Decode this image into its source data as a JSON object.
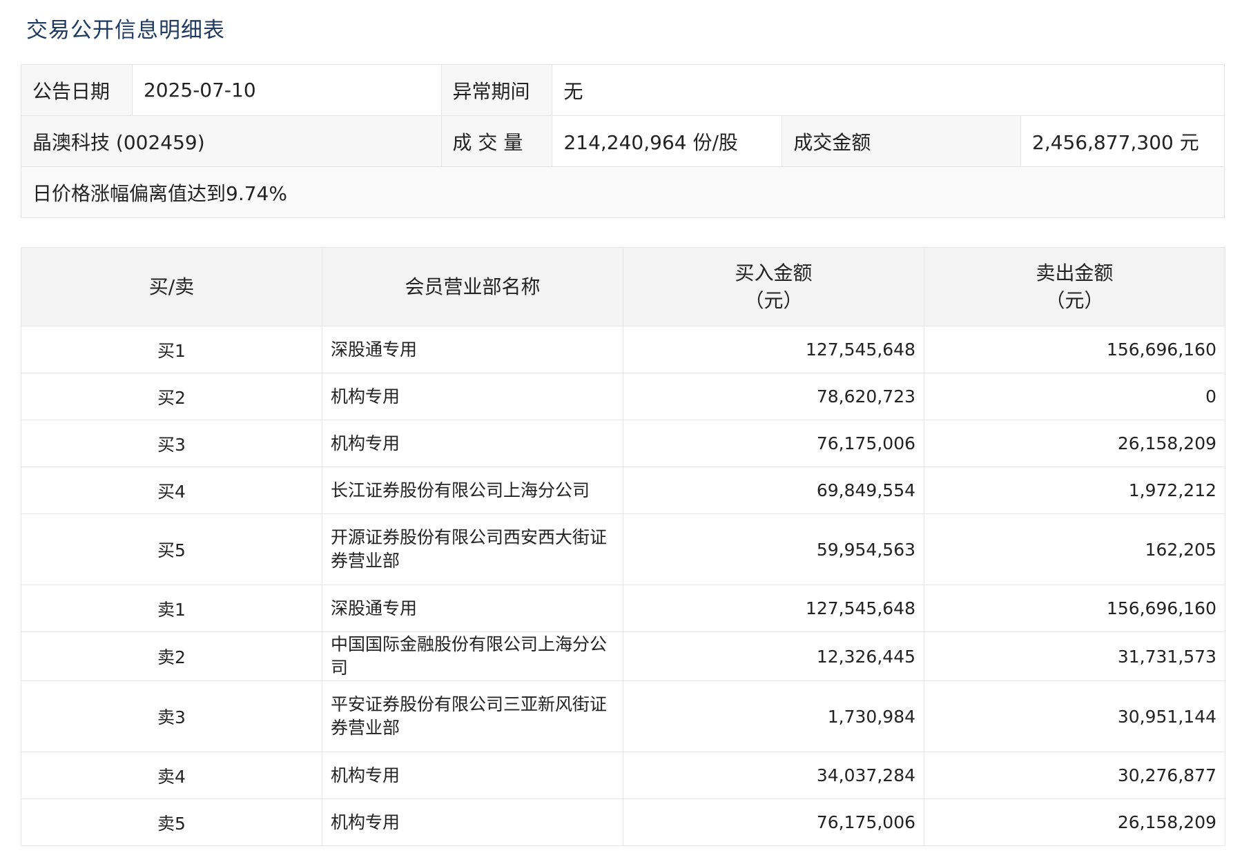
{
  "title": "交易公开信息明细表",
  "info": {
    "date_label": "公告日期",
    "date_value": "2025-07-10",
    "period_label": "异常期间",
    "period_value": "无",
    "stock_name": "晶澳科技 (002459)",
    "volume_label": "成 交 量",
    "volume_value": "214,240,964 份/股",
    "amount_label": "成交金额",
    "amount_value": "2,456,877,300 元",
    "reason": "日价格涨幅偏离值达到9.74%"
  },
  "table": {
    "headers": {
      "side": "买/卖",
      "member": "会员营业部名称",
      "buy_line1": "买入金额",
      "buy_line2": "（元）",
      "sell_line1": "卖出金额",
      "sell_line2": "（元）"
    },
    "rows": [
      {
        "side": "买1",
        "name": "深股通专用",
        "buy": "127,545,648",
        "sell": "156,696,160"
      },
      {
        "side": "买2",
        "name": "机构专用",
        "buy": "78,620,723",
        "sell": "0"
      },
      {
        "side": "买3",
        "name": "机构专用",
        "buy": "76,175,006",
        "sell": "26,158,209"
      },
      {
        "side": "买4",
        "name": "长江证券股份有限公司上海分公司",
        "buy": "69,849,554",
        "sell": "1,972,212"
      },
      {
        "side": "买5",
        "name": "开源证券股份有限公司西安西大街证券营业部",
        "buy": "59,954,563",
        "sell": "162,205"
      },
      {
        "side": "卖1",
        "name": "深股通专用",
        "buy": "127,545,648",
        "sell": "156,696,160"
      },
      {
        "side": "卖2",
        "name": "中国国际金融股份有限公司上海分公司",
        "buy": "12,326,445",
        "sell": "31,731,573"
      },
      {
        "side": "卖3",
        "name": "平安证券股份有限公司三亚新风街证券营业部",
        "buy": "1,730,984",
        "sell": "30,951,144"
      },
      {
        "side": "卖4",
        "name": "机构专用",
        "buy": "34,037,284",
        "sell": "30,276,877"
      },
      {
        "side": "卖5",
        "name": "机构专用",
        "buy": "76,175,006",
        "sell": "26,158,209"
      }
    ]
  }
}
